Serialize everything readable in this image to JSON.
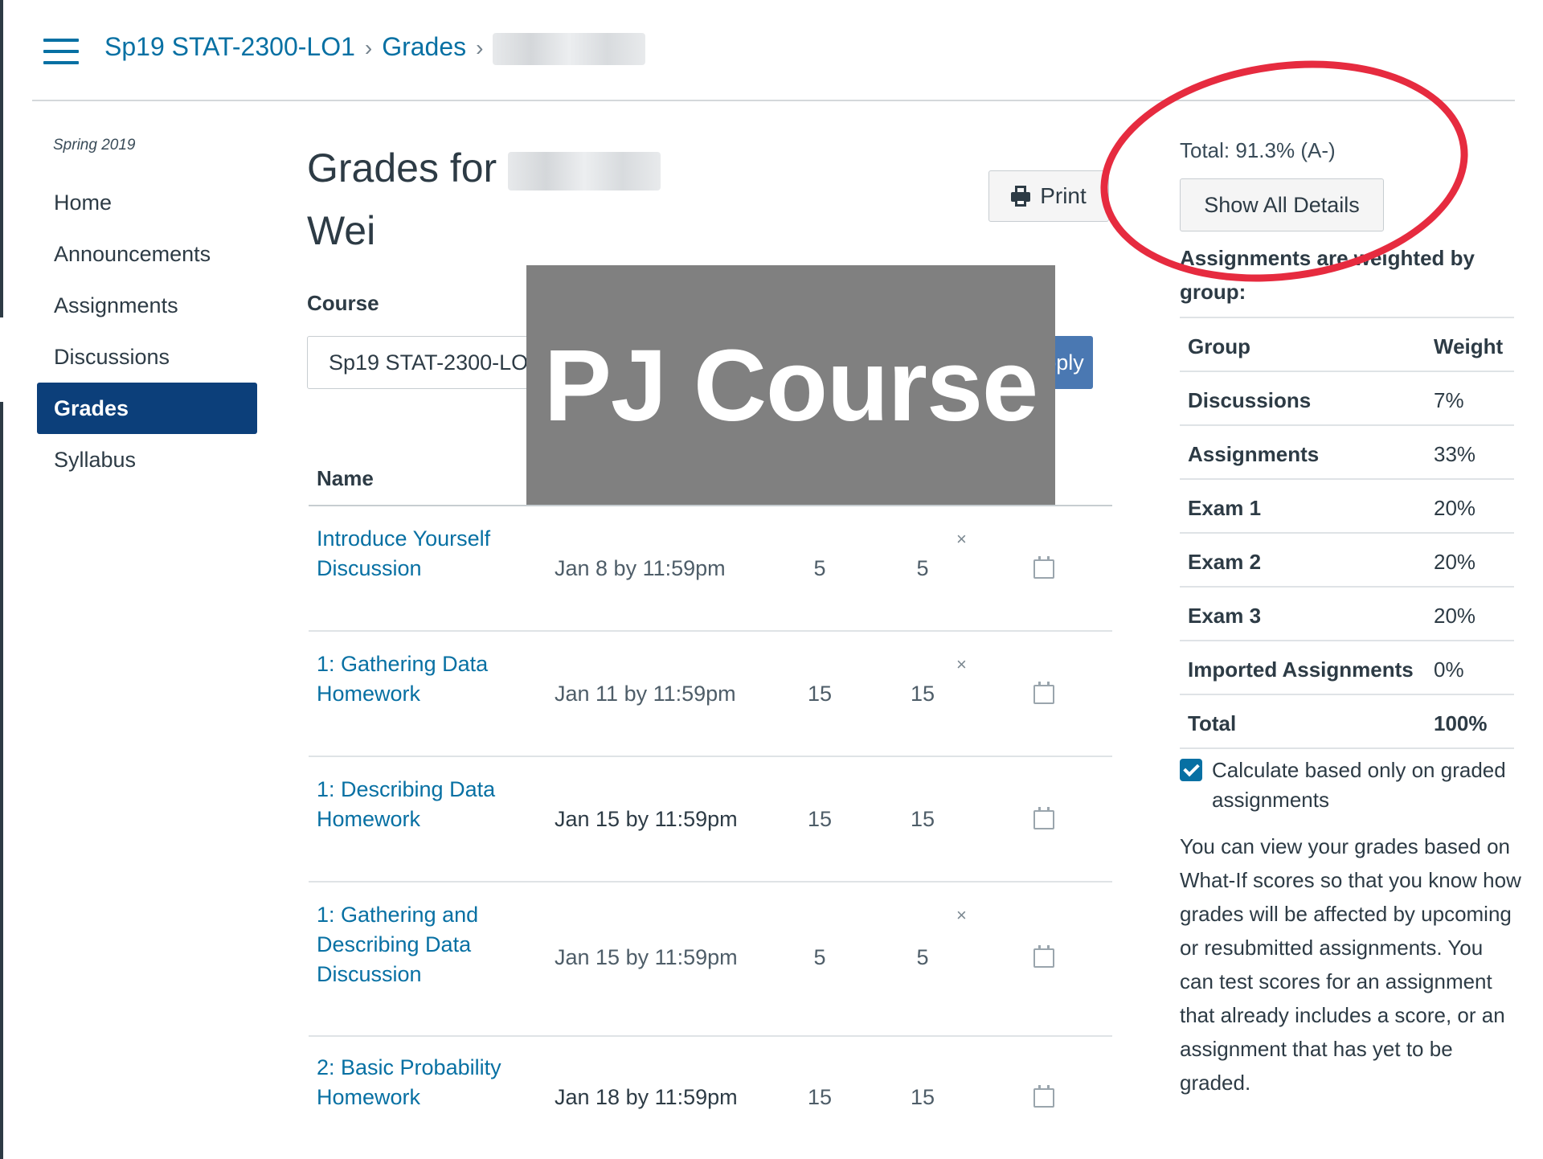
{
  "breadcrumb": {
    "course": "Sp19 STAT-2300-LO1",
    "section": "Grades"
  },
  "sidebar": {
    "term": "Spring 2019",
    "items": [
      {
        "label": "Home",
        "active": false
      },
      {
        "label": "Announcements",
        "active": false
      },
      {
        "label": "Assignments",
        "active": false
      },
      {
        "label": "Discussions",
        "active": false
      },
      {
        "label": "Grades",
        "active": true
      },
      {
        "label": "Syllabus",
        "active": false
      }
    ]
  },
  "main": {
    "title_prefix": "Grades for",
    "title_suffix": "Wei",
    "print_label": "Print",
    "course_label": "Course",
    "course_value": "Sp19 STAT-2300-LO",
    "apply_label": "Apply",
    "overlay_text": "PJ Course",
    "name_header": "Name",
    "rows": [
      {
        "name": "Introduce Yourself Discussion",
        "due": "Jan 8 by 11:59pm",
        "score": "5",
        "out_of": "5",
        "dismiss": "×"
      },
      {
        "name": "1: Gathering Data Homework",
        "due": "Jan 11 by 11:59pm",
        "score": "15",
        "out_of": "15",
        "dismiss": "×"
      },
      {
        "name": "1: Describing Data Homework",
        "due": "Jan 15 by 11:59pm",
        "score": "15",
        "out_of": "15",
        "dismiss": ""
      },
      {
        "name": "1: Gathering and Describing Data Discussion",
        "due": "Jan 15 by 11:59pm",
        "score": "5",
        "out_of": "5",
        "dismiss": "×"
      },
      {
        "name": "2: Basic Probability Homework",
        "due": "Jan 18 by 11:59pm",
        "score": "15",
        "out_of": "15",
        "dismiss": ""
      }
    ]
  },
  "right_panel": {
    "total": "Total: 91.3% (A-)",
    "show_details": "Show All Details",
    "weighted_note": "Assignments are weighted by group:",
    "weights_header": {
      "group": "Group",
      "weight": "Weight"
    },
    "weights": [
      {
        "group": "Discussions",
        "weight": "7%"
      },
      {
        "group": "Assignments",
        "weight": "33%"
      },
      {
        "group": "Exam 1",
        "weight": "20%"
      },
      {
        "group": "Exam 2",
        "weight": "20%"
      },
      {
        "group": "Exam 3",
        "weight": "20%"
      },
      {
        "group": "Imported Assignments",
        "weight": "0%"
      }
    ],
    "weights_total": {
      "group": "Total",
      "weight": "100%"
    },
    "checkbox_label": "Calculate based only on graded assignments",
    "checkbox_checked": true,
    "whatif_text": "You can view your grades based on What-If scores so that you know how grades will be affected by upcoming or resubmitted assignments. You can test scores for an assignment that already includes a score, or an assignment that has yet to be graded."
  },
  "colors": {
    "link": "#0770a3",
    "nav_active": "#0c3f7a",
    "highlight_circle": "#e62b3f",
    "overlay": "#808080"
  }
}
